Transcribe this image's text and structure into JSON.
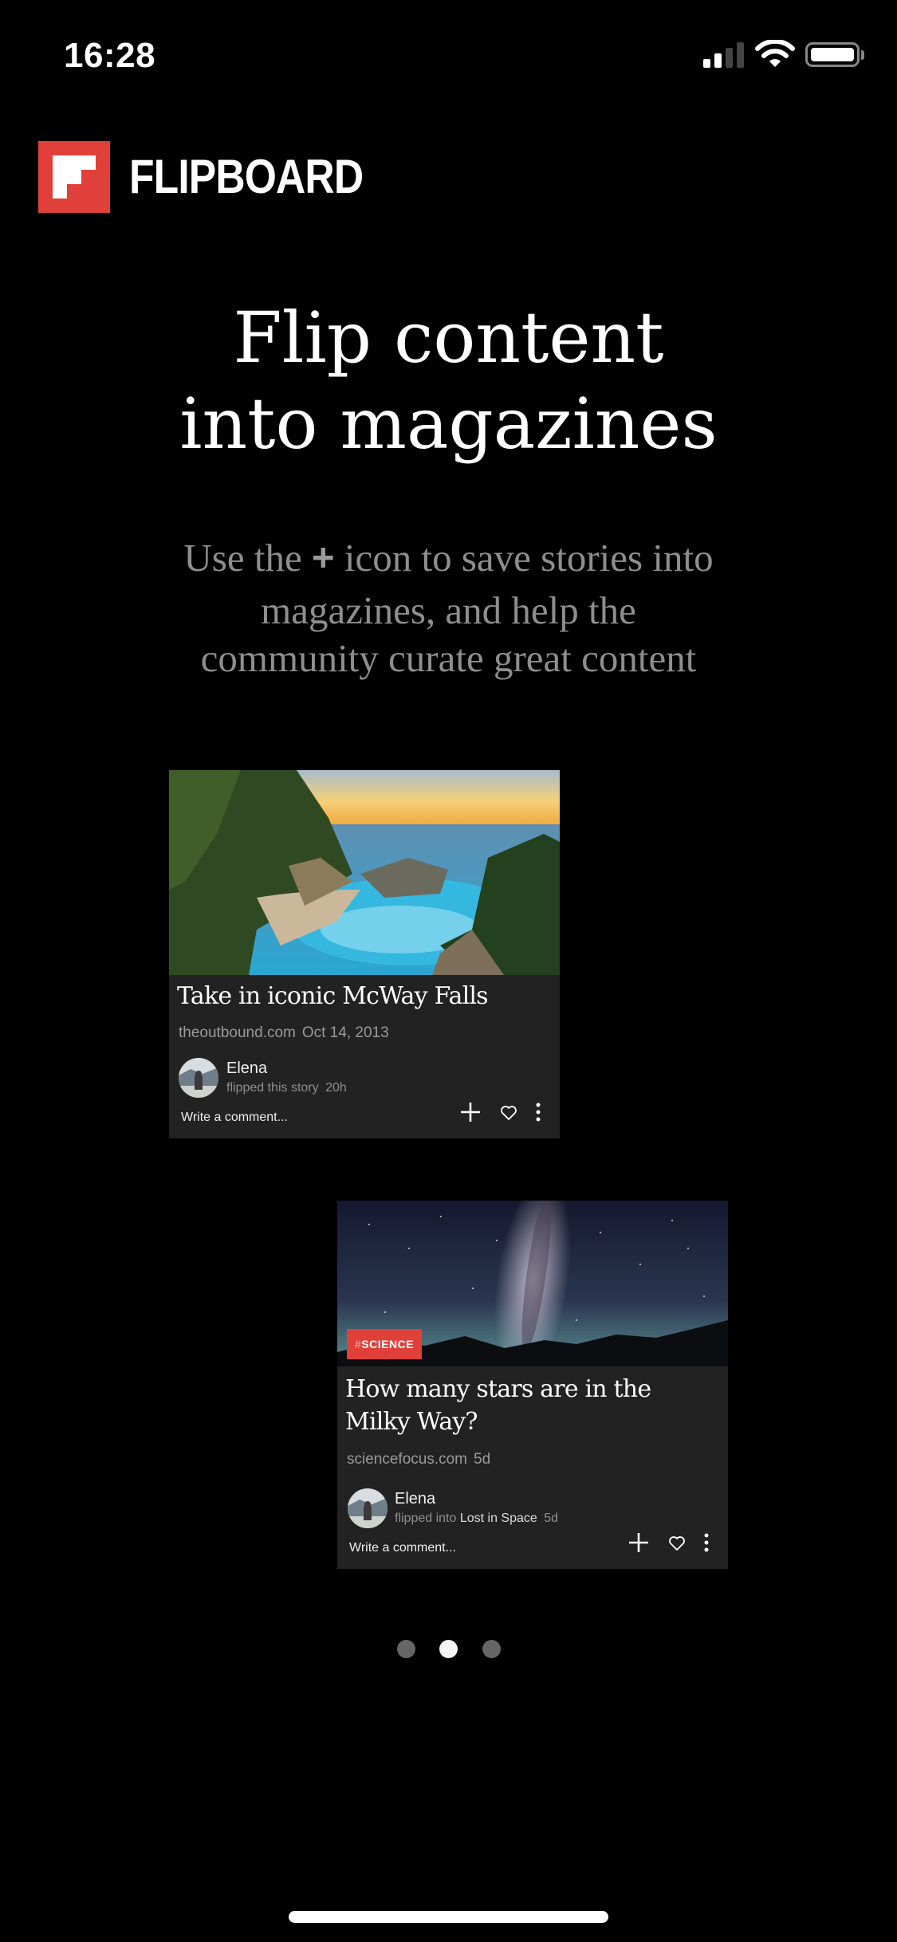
{
  "status_bar": {
    "time": "16:28",
    "signal_bars_filled": 2,
    "signal_bars_total": 4,
    "battery_level": 0.95,
    "wifi": "wifi-icon"
  },
  "brand": {
    "name": "FLIPBOARD",
    "color": "#e0403a"
  },
  "headline": {
    "line1": "Flip content",
    "line2": "into magazines"
  },
  "subtitle": {
    "before_icon": "Use the ",
    "icon": "+",
    "after_icon": " icon to save stories into",
    "line2": "magazines, and help the",
    "line3": "community curate great content"
  },
  "cards": [
    {
      "image": "coastal-cove-waterfall-photo",
      "title": "Take in iconic McWay Falls",
      "source": "theoutbound.com",
      "date": "Oct 14, 2013",
      "author": "Elena",
      "activity": "flipped this story",
      "magazine": "",
      "age": "20h",
      "comment_placeholder": "Write a comment...",
      "actions": [
        "plus-icon",
        "heart-icon",
        "more-icon"
      ]
    },
    {
      "image": "milky-way-night-sky-photo",
      "badge_hash": "#",
      "badge": "SCIENCE",
      "title": "How many stars are in the Milky Way?",
      "source": "sciencefocus.com",
      "date": "5d",
      "author": "Elena",
      "activity": "flipped into ",
      "magazine": "Lost in Space",
      "age": "5d",
      "comment_placeholder": "Write a comment...",
      "actions": [
        "plus-icon",
        "heart-icon",
        "more-icon"
      ]
    }
  ],
  "pager": {
    "total": 3,
    "active_index": 1,
    "active_color": "#f5f5f5",
    "inactive_color": "#666666"
  }
}
